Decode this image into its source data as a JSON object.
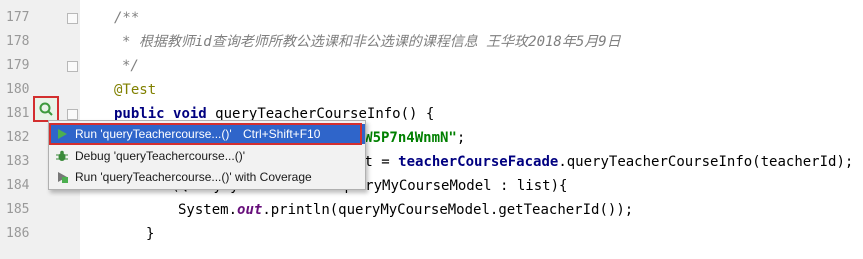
{
  "editor": {
    "line_numbers": [
      "177",
      "178",
      "179",
      "180",
      "181",
      "182",
      "183",
      "184",
      "185",
      "186"
    ],
    "lines": {
      "l177": "/**",
      "l178": "* 根据教师id查询老师所教公选课和非公选课的课程信息 王华玫2018年5月9日",
      "l179": "*/",
      "l180": "@Test",
      "l181_kw1": "public",
      "l181_kw2": "void",
      "l181_rest": "queryTeacherCourseInfo() {",
      "l182_str": "MvX9ZW5P7n4WnmN\"",
      "l182_end": ";",
      "l183_pre": "st = ",
      "l183_field": "teacherCourseFacade",
      "l183_rest": ".queryTeacherCourseInfo(teacherId);",
      "l184_kw": "for",
      "l184_rest": "(QueryMyCourseModel queryMyCourseModel : list){",
      "l185_pre": "System.",
      "l185_field": "out",
      "l185_rest": ".println(queryMyCourseModel.getTeacherId());",
      "l186": "}"
    }
  },
  "popup_menu": {
    "items": [
      {
        "label": "Run 'queryTeachercourse...()'",
        "shortcut": "Ctrl+Shift+F10",
        "icon": "run-icon"
      },
      {
        "label": "Debug 'queryTeachercourse...()'",
        "icon": "debug-icon"
      },
      {
        "label": "Run 'queryTeachercourse...()' with Coverage",
        "icon": "coverage-icon"
      }
    ]
  },
  "colors": {
    "selection": "#2f65ca",
    "highlight_border": "#d32f2f",
    "comment": "#808080",
    "keyword": "#000080",
    "string": "#008000",
    "annotation": "#808000"
  }
}
